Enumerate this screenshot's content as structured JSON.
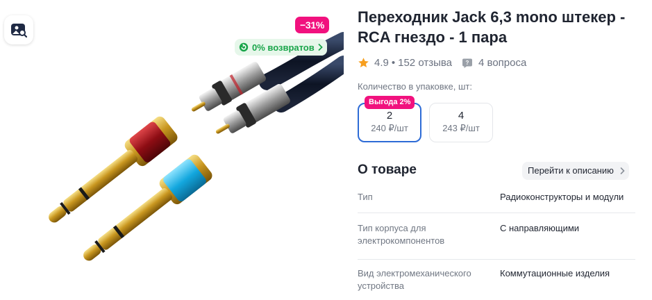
{
  "gallery": {
    "discount": "−31%",
    "returns": "0% возвратов",
    "visual_search_icon": "image-search-icon"
  },
  "product": {
    "title": "Переходник Jack 6,3 mono штекер - RCA гнездо - 1 пара",
    "rating": "4.9",
    "reviews": "152 отзыва",
    "questions": "4 вопроса"
  },
  "quantity": {
    "label": "Количество в упаковке, шт:",
    "options": [
      {
        "count": "2",
        "price": "240 ₽/шт",
        "badge": "Выгода 2%",
        "selected": true
      },
      {
        "count": "4",
        "price": "243 ₽/шт",
        "selected": false
      }
    ]
  },
  "about": {
    "title": "О товаре",
    "link": "Перейти к описанию",
    "specs": [
      {
        "key": "Тип",
        "value": "Радиоконструкторы и модули"
      },
      {
        "key": "Тип корпуса для электрокомпонентов",
        "value": "С направляющими"
      },
      {
        "key": "Вид электромеханического устройства",
        "value": "Коммутационные изделия"
      }
    ]
  },
  "colors": {
    "accent_pink": "#f1117e",
    "rating_star": "#f79f1f",
    "returns_green": "#19a54a",
    "selected_border": "#2d6bd6"
  }
}
